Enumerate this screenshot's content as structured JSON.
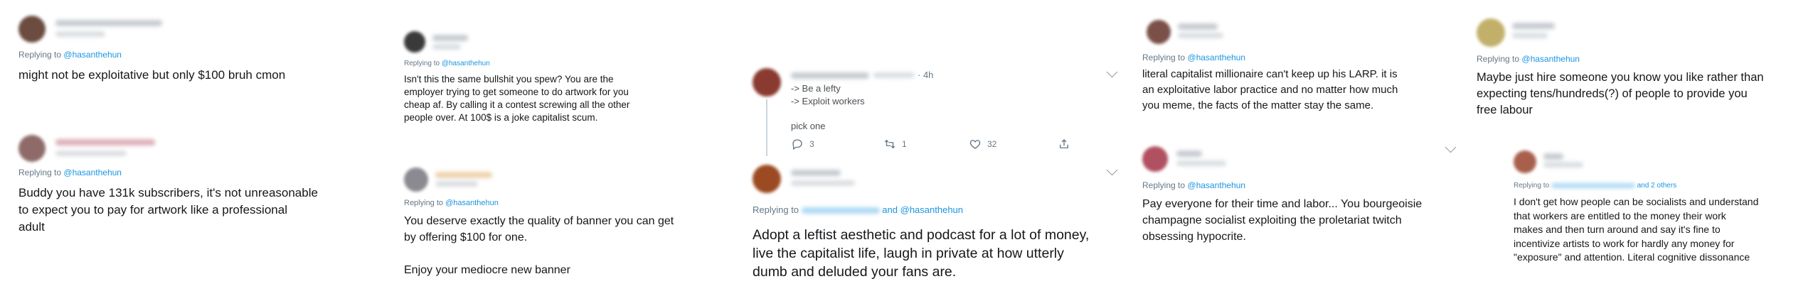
{
  "colors": {
    "link": "#1b95e0",
    "muted": "#657786",
    "text": "#14171a"
  },
  "col1": {
    "t1": {
      "replying_prefix": "Replying to",
      "mention": "@hasanthehun",
      "text": "might not be exploitative but only $100 bruh cmon"
    },
    "t2": {
      "replying_prefix": "Replying to",
      "mention": "@hasanthehun",
      "text": "Buddy you have 131k subscribers, it's not unreasonable\nto expect you to pay for artwork like a professional\nadult"
    }
  },
  "col2": {
    "t1": {
      "replying_prefix": "Replying to",
      "mention": "@hasanthehun",
      "text": "Isn't this the same bullshit you spew? You are the\nemployer trying to get someone to do artwork for you\ncheap af. By calling it a contest screwing all the other\npeople over. At 100$ is a joke capitalist scum."
    },
    "t2": {
      "replying_prefix": "Replying to",
      "mention": "@hasanthehun",
      "text": "You deserve exactly the quality of banner you can get\nby offering $100 for one.\n\nEnjoy your mediocre new banner"
    }
  },
  "col3": {
    "t1": {
      "time": "· 4h",
      "text": "-> Be a lefty\n-> Exploit workers\n\npick one",
      "reply_count": "3",
      "retweet_count": "1",
      "like_count": "32",
      "icons": [
        "reply-icon",
        "retweet-icon",
        "like-icon",
        "share-icon",
        "chevron-down-icon"
      ]
    },
    "t2": {
      "replying_prefix": "Replying to",
      "joiner": "and",
      "mention": "@hasanthehun",
      "text": "Adopt a leftist aesthetic and podcast for a lot of money,\nlive the capitalist life, laugh in private at how utterly\ndumb and deluded your fans are."
    }
  },
  "col4": {
    "t1": {
      "replying_prefix": "Replying to",
      "mention": "@hasanthehun",
      "text": "literal capitalist millionaire can't keep up his LARP. it is\nan exploitative labor practice and no matter how much\nyou meme, the facts of the matter stay the same."
    },
    "t2": {
      "replying_prefix": "Replying to",
      "mention": "@hasanthehun",
      "text": "Pay everyone for their time and labor... You bourgeoisie\nchampagne socialist exploiting the proletariat twitch\nobsessing hypocrite."
    }
  },
  "col5": {
    "t1": {
      "replying_prefix": "Replying to",
      "mention": "@hasanthehun",
      "text": "Maybe just hire someone you know you like rather than\nexpecting tens/hundreds(?) of people to provide you\nfree labour"
    },
    "t2": {
      "replying_prefix": "Replying to",
      "and_others": "and 2 others",
      "text": "I don't get how people can be socialists and understand\nthat workers are entitled to the money their work\nmakes and then turn around and say it's fine to\nincentivize artists to work for hardly any money for\n\"exposure\" and attention. Literal cognitive dissonance"
    }
  }
}
